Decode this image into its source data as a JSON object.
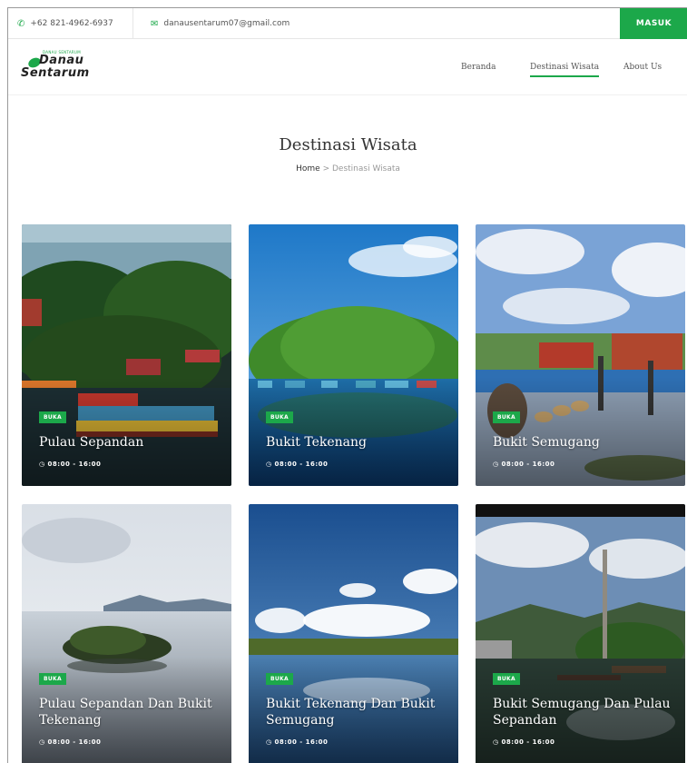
{
  "topbar": {
    "phone": "+62 821-4962-6937",
    "email": "danausentarum07@gmail.com",
    "login_label": "MASUK"
  },
  "brand": {
    "tagline": "DANAU SENTARUM",
    "line1": "Danau",
    "line2": "Sentarum"
  },
  "nav": {
    "items": [
      {
        "label": "Beranda"
      },
      {
        "label": "Destinasi Wisata"
      },
      {
        "label": "About Us"
      }
    ]
  },
  "page": {
    "title": "Destinasi Wisata",
    "breadcrumb": {
      "home": "Home",
      "separator": ">",
      "current": "Destinasi Wisata"
    }
  },
  "cards": [
    {
      "title": "Pulau Sepandan",
      "status": "BUKA",
      "hours": "08:00 - 16:00"
    },
    {
      "title": "Bukit Tekenang",
      "status": "BUKA",
      "hours": "08:00 - 16:00"
    },
    {
      "title": "Bukit Semugang",
      "status": "BUKA",
      "hours": "08:00 - 16:00"
    },
    {
      "title": "Pulau Sepandan Dan Bukit Tekenang",
      "status": "BUKA",
      "hours": "08:00 - 16:00"
    },
    {
      "title": "Bukit Tekenang Dan Bukit Semugang",
      "status": "BUKA",
      "hours": "08:00 - 16:00"
    },
    {
      "title": "Bukit Semugang Dan Pulau Sepandan",
      "status": "BUKA",
      "hours": "08:00 - 16:00"
    }
  ],
  "colors": {
    "accent": "#1ca84a"
  }
}
